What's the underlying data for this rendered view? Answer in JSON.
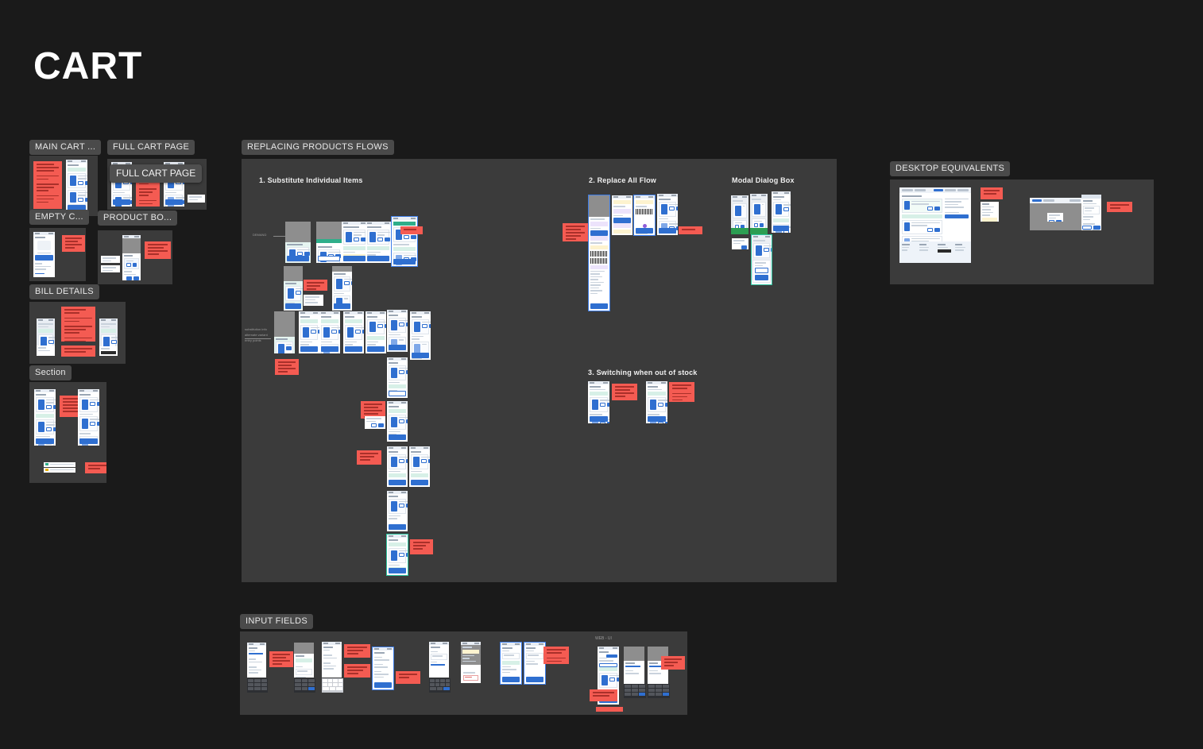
{
  "page": {
    "title": "CART",
    "background_color": "#1a1a1a",
    "frame_color": "#3b3b3b",
    "label_chip_color": "#4a4a4a",
    "note_color": "#f45b52",
    "accent_blue": "#2f6fd0",
    "accent_green": "#2fae8a"
  },
  "sections": {
    "main_cart": {
      "label": "MAIN CART ..."
    },
    "full_cart_page": {
      "label": "FULL CART PAGE"
    },
    "full_cart_page_tooltip": {
      "label": "FULL CART PAGE"
    },
    "empty_cart": {
      "label": "EMPTY C..."
    },
    "product_box": {
      "label": "PRODUCT BO..."
    },
    "bill_details": {
      "label": "BILL DETAILS"
    },
    "section": {
      "label": "Section"
    },
    "replacing_products_flows": {
      "label": "REPLACING PRODUCTS FLOWS"
    },
    "desktop_equivalents": {
      "label": "DESKTOP EQUIVALENTS"
    },
    "input_fields": {
      "label": "INPUT FIELDS"
    }
  },
  "flows": {
    "flow_1": {
      "heading": "1. Substitute Individual Items"
    },
    "flow_2": {
      "heading": "2. Replace All Flow"
    },
    "flow_3": {
      "heading": "3. Switching when out of stock"
    },
    "modal_dialog": {
      "heading": "Modal Dialog Box"
    }
  },
  "captions": {
    "flow1_left": "DEMAND",
    "flow1_row3_left": "Substitution flow\nalternate variant\nentry point",
    "input_fields_caption": "WEB - UI"
  }
}
